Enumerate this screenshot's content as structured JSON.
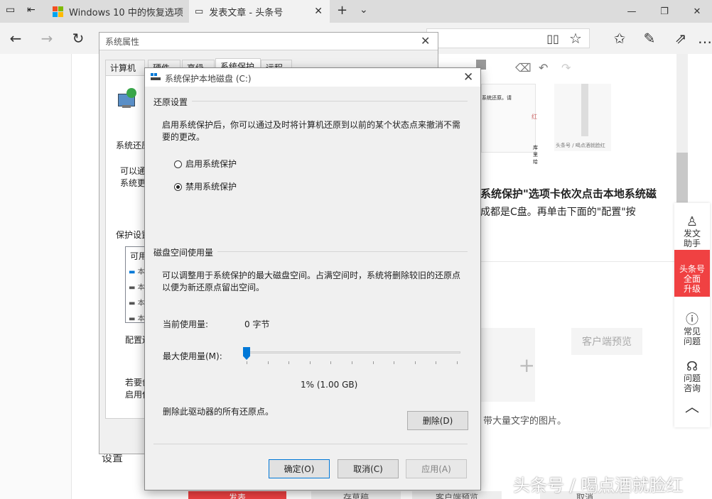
{
  "browser": {
    "tabs": [
      {
        "title": "Windows 10 中的恢复选项",
        "active": false
      },
      {
        "title": "发表文章 - 头条号",
        "active": true
      }
    ]
  },
  "page": {
    "article_text_1": "系统保护\"选项卡依次点击本地系统磁",
    "article_text_2": "成都是C盘。再单击下面的\"配置\"按",
    "client_preview": "客户端预览",
    "image_hint": "带大量文字的图片。",
    "settings_label": "设置",
    "sidebar": [
      {
        "label": "发文\n助手",
        "icon": "assistant-icon"
      },
      {
        "label": "头条号\n全面\n升级",
        "icon": ""
      },
      {
        "label": "常见\n问题",
        "icon": "question-icon"
      },
      {
        "label": "问题\n咨询",
        "icon": "headset-icon"
      }
    ],
    "bottom_buttons": [
      "发表",
      "存草稿",
      "客户端预览",
      "取消"
    ],
    "thumb_small_1": "系统还原。请",
    "thumb_small_2": "红",
    "thumb_small_3": "库里给",
    "thumb_small_4": "头条号 / 喝点酒就脸红"
  },
  "sysprops": {
    "title": "系统属性",
    "tabs": [
      "计算机名",
      "硬件",
      "高级",
      "系统保护",
      "远程"
    ],
    "system_restore": "系统还原",
    "can_use_1": "可以通",
    "can_use_2": "系统更",
    "protect_settings": "保护设置",
    "available": "可用",
    "drives": [
      "本",
      "本",
      "本",
      "本"
    ],
    "configure": "配置还",
    "bottom_1": "若要创",
    "bottom_2": "启用保"
  },
  "dialog": {
    "title": "系统保护本地磁盘 (C:)",
    "restore_group": "还原设置",
    "restore_desc": "启用系统保护后，你可以通过及时将计算机还原到以前的某个状态点来撤消不需要的更改。",
    "radio_enable": "启用系统保护",
    "radio_disable": "禁用系统保护",
    "selected_radio": "disable",
    "disk_group": "磁盘空间使用量",
    "disk_desc": "可以调整用于系统保护的最大磁盘空间。占满空间时，系统将删除较旧的还原点以便为新还原点留出空间。",
    "current_usage_label": "当前使用量:",
    "current_usage_value": "0 字节",
    "max_usage_label": "最大使用量(M):",
    "slider_percent": 1,
    "slider_value_text": "1% (1.00 GB)",
    "delete_desc": "删除此驱动器的所有还原点。",
    "delete_button": "删除(D)",
    "ok_button": "确定(O)",
    "cancel_button": "取消(C)",
    "apply_button": "应用(A)"
  },
  "watermark": "头条号 / 喝点酒就脸红",
  "colors": {
    "accent": "#0078d7",
    "brand_red": "#f04142"
  }
}
